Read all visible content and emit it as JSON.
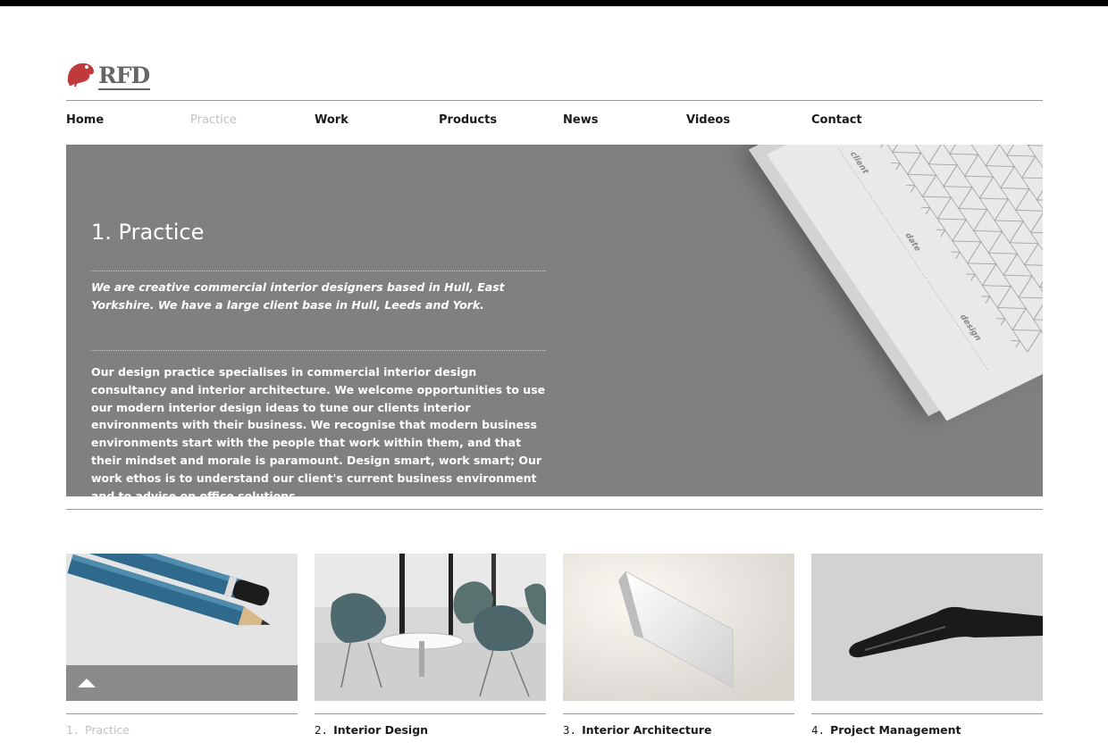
{
  "brand": {
    "logo_text": "RFD",
    "logo_icon": "frog-logo-icon",
    "accent_color": "#c0393b"
  },
  "nav": {
    "items": [
      {
        "label": "Home"
      },
      {
        "label": "Practice",
        "active": true
      },
      {
        "label": "Work"
      },
      {
        "label": "Products"
      },
      {
        "label": "News"
      },
      {
        "label": "Videos"
      },
      {
        "label": "Contact"
      }
    ]
  },
  "hero": {
    "title": "1. Practice",
    "intro": "We are creative commercial interior designers based in Hull, East Yorkshire. We have a large client base in Hull, Leeds and York.",
    "body": "Our design practice specialises in commercial interior design consultancy and interior architecture. We welcome opportunities to use our modern interior design ideas to tune our clients interior environments with their business. We recognise that modern business environments start with the people that work within them, and that their mindset and morale is paramount. Design smart, work smart; Our work ethos is to understand our client's current business environment and to advise on office solutions.",
    "pad_labels": {
      "client": "client",
      "date": "date",
      "design": "design"
    }
  },
  "cards": [
    {
      "number": "1.",
      "label": "Practice",
      "active": true,
      "image": "pencils"
    },
    {
      "number": "2.",
      "label": "Interior Design",
      "image": "chairs"
    },
    {
      "number": "3.",
      "label": "Interior Architecture",
      "image": "wall-light"
    },
    {
      "number": "4.",
      "label": "Project Management",
      "image": "pen"
    }
  ]
}
